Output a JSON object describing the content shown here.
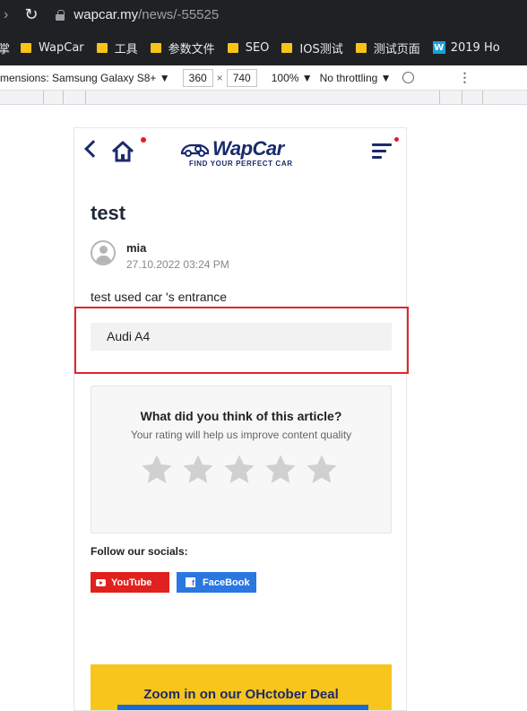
{
  "browser": {
    "url_domain": "wapcar.my",
    "url_path": "/news/-55525",
    "bookmarks_first_fragment": "掌",
    "bookmarks": [
      {
        "label": "WapCar",
        "icon": "folder-icon"
      },
      {
        "label": "工具",
        "icon": "folder-icon"
      },
      {
        "label": "参数文件",
        "icon": "folder-icon"
      },
      {
        "label": "SEO",
        "icon": "folder-icon"
      },
      {
        "label": "IOS测试",
        "icon": "folder-icon"
      },
      {
        "label": "测试页面",
        "icon": "folder-icon"
      },
      {
        "label": "2019 Ho",
        "icon": "w-logo-icon"
      }
    ],
    "w_badge": "W"
  },
  "devtools": {
    "dimensions_label": "mensions: Samsung Galaxy S8+ ▼",
    "width_value": "360",
    "times": "×",
    "height_value": "740",
    "zoom": "100% ▼",
    "throttle": "No throttling ▼",
    "more": "⋮"
  },
  "site": {
    "logo_text": "WapCar",
    "logo_tagline": "FIND YOUR PERFECT CAR",
    "accent_color": "#1a2a6b",
    "notify_color": "#e5192e"
  },
  "article": {
    "title": "test",
    "author": "mia",
    "date": "27.10.2022 03:24 PM",
    "body": "test used car 's entrance",
    "used_car_item": "Audi A4"
  },
  "rating": {
    "title": "What did you think of this article?",
    "subtitle": "Your rating will help us improve content quality",
    "stars_selected": 0,
    "stars_total": 5
  },
  "socials": {
    "label": "Follow our socials:",
    "youtube": "YouTube",
    "facebook": "FaceBook",
    "fb_glyph": "f"
  },
  "promo": {
    "text": "Zoom in on our OHctober Deal"
  }
}
